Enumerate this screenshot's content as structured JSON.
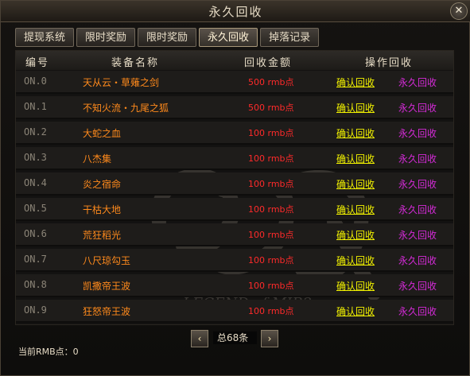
{
  "window": {
    "title": "永久回收",
    "close_label": "✕"
  },
  "tabs": [
    "提现系统",
    "限时奖励",
    "限时奖励",
    "永久回收",
    "掉落记录"
  ],
  "table": {
    "headers": [
      "编号",
      "装备名称",
      "回收金额",
      "操作回收"
    ],
    "rows": [
      {
        "no": "ON.0",
        "name": "天从云・草薙之剑",
        "price": "500 rmb点",
        "confirm": "确认回收",
        "perm": "永久回收"
      },
      {
        "no": "ON.1",
        "name": "不知火流・九尾之狐",
        "price": "500 rmb点",
        "confirm": "确认回收",
        "perm": "永久回收"
      },
      {
        "no": "ON.2",
        "name": "大蛇之血",
        "price": "100 rmb点",
        "confirm": "确认回收",
        "perm": "永久回收"
      },
      {
        "no": "ON.3",
        "name": "八杰集",
        "price": "100 rmb点",
        "confirm": "确认回收",
        "perm": "永久回收"
      },
      {
        "no": "ON.4",
        "name": "炎之宿命",
        "price": "100 rmb点",
        "confirm": "确认回收",
        "perm": "永久回收"
      },
      {
        "no": "ON.5",
        "name": "干枯大地",
        "price": "100 rmb点",
        "confirm": "确认回收",
        "perm": "永久回收"
      },
      {
        "no": "ON.6",
        "name": "荒狂稻光",
        "price": "100 rmb点",
        "confirm": "确认回收",
        "perm": "永久回收"
      },
      {
        "no": "ON.7",
        "name": "八尺琼勾玉",
        "price": "100 rmb点",
        "confirm": "确认回收",
        "perm": "永久回收"
      },
      {
        "no": "ON.8",
        "name": "凯撒帝王波",
        "price": "100 rmb点",
        "confirm": "确认回收",
        "perm": "永久回收"
      },
      {
        "no": "ON.9",
        "name": "狂怒帝王波",
        "price": "100 rmb点",
        "confirm": "确认回收",
        "perm": "永久回收"
      }
    ]
  },
  "watermark": {
    "text": "LEGEND of MIR2"
  },
  "pager": {
    "prev_icon": "‹",
    "next_icon": "›",
    "total": "总68条"
  },
  "footer": {
    "rmb": "当前RMB点：0"
  }
}
